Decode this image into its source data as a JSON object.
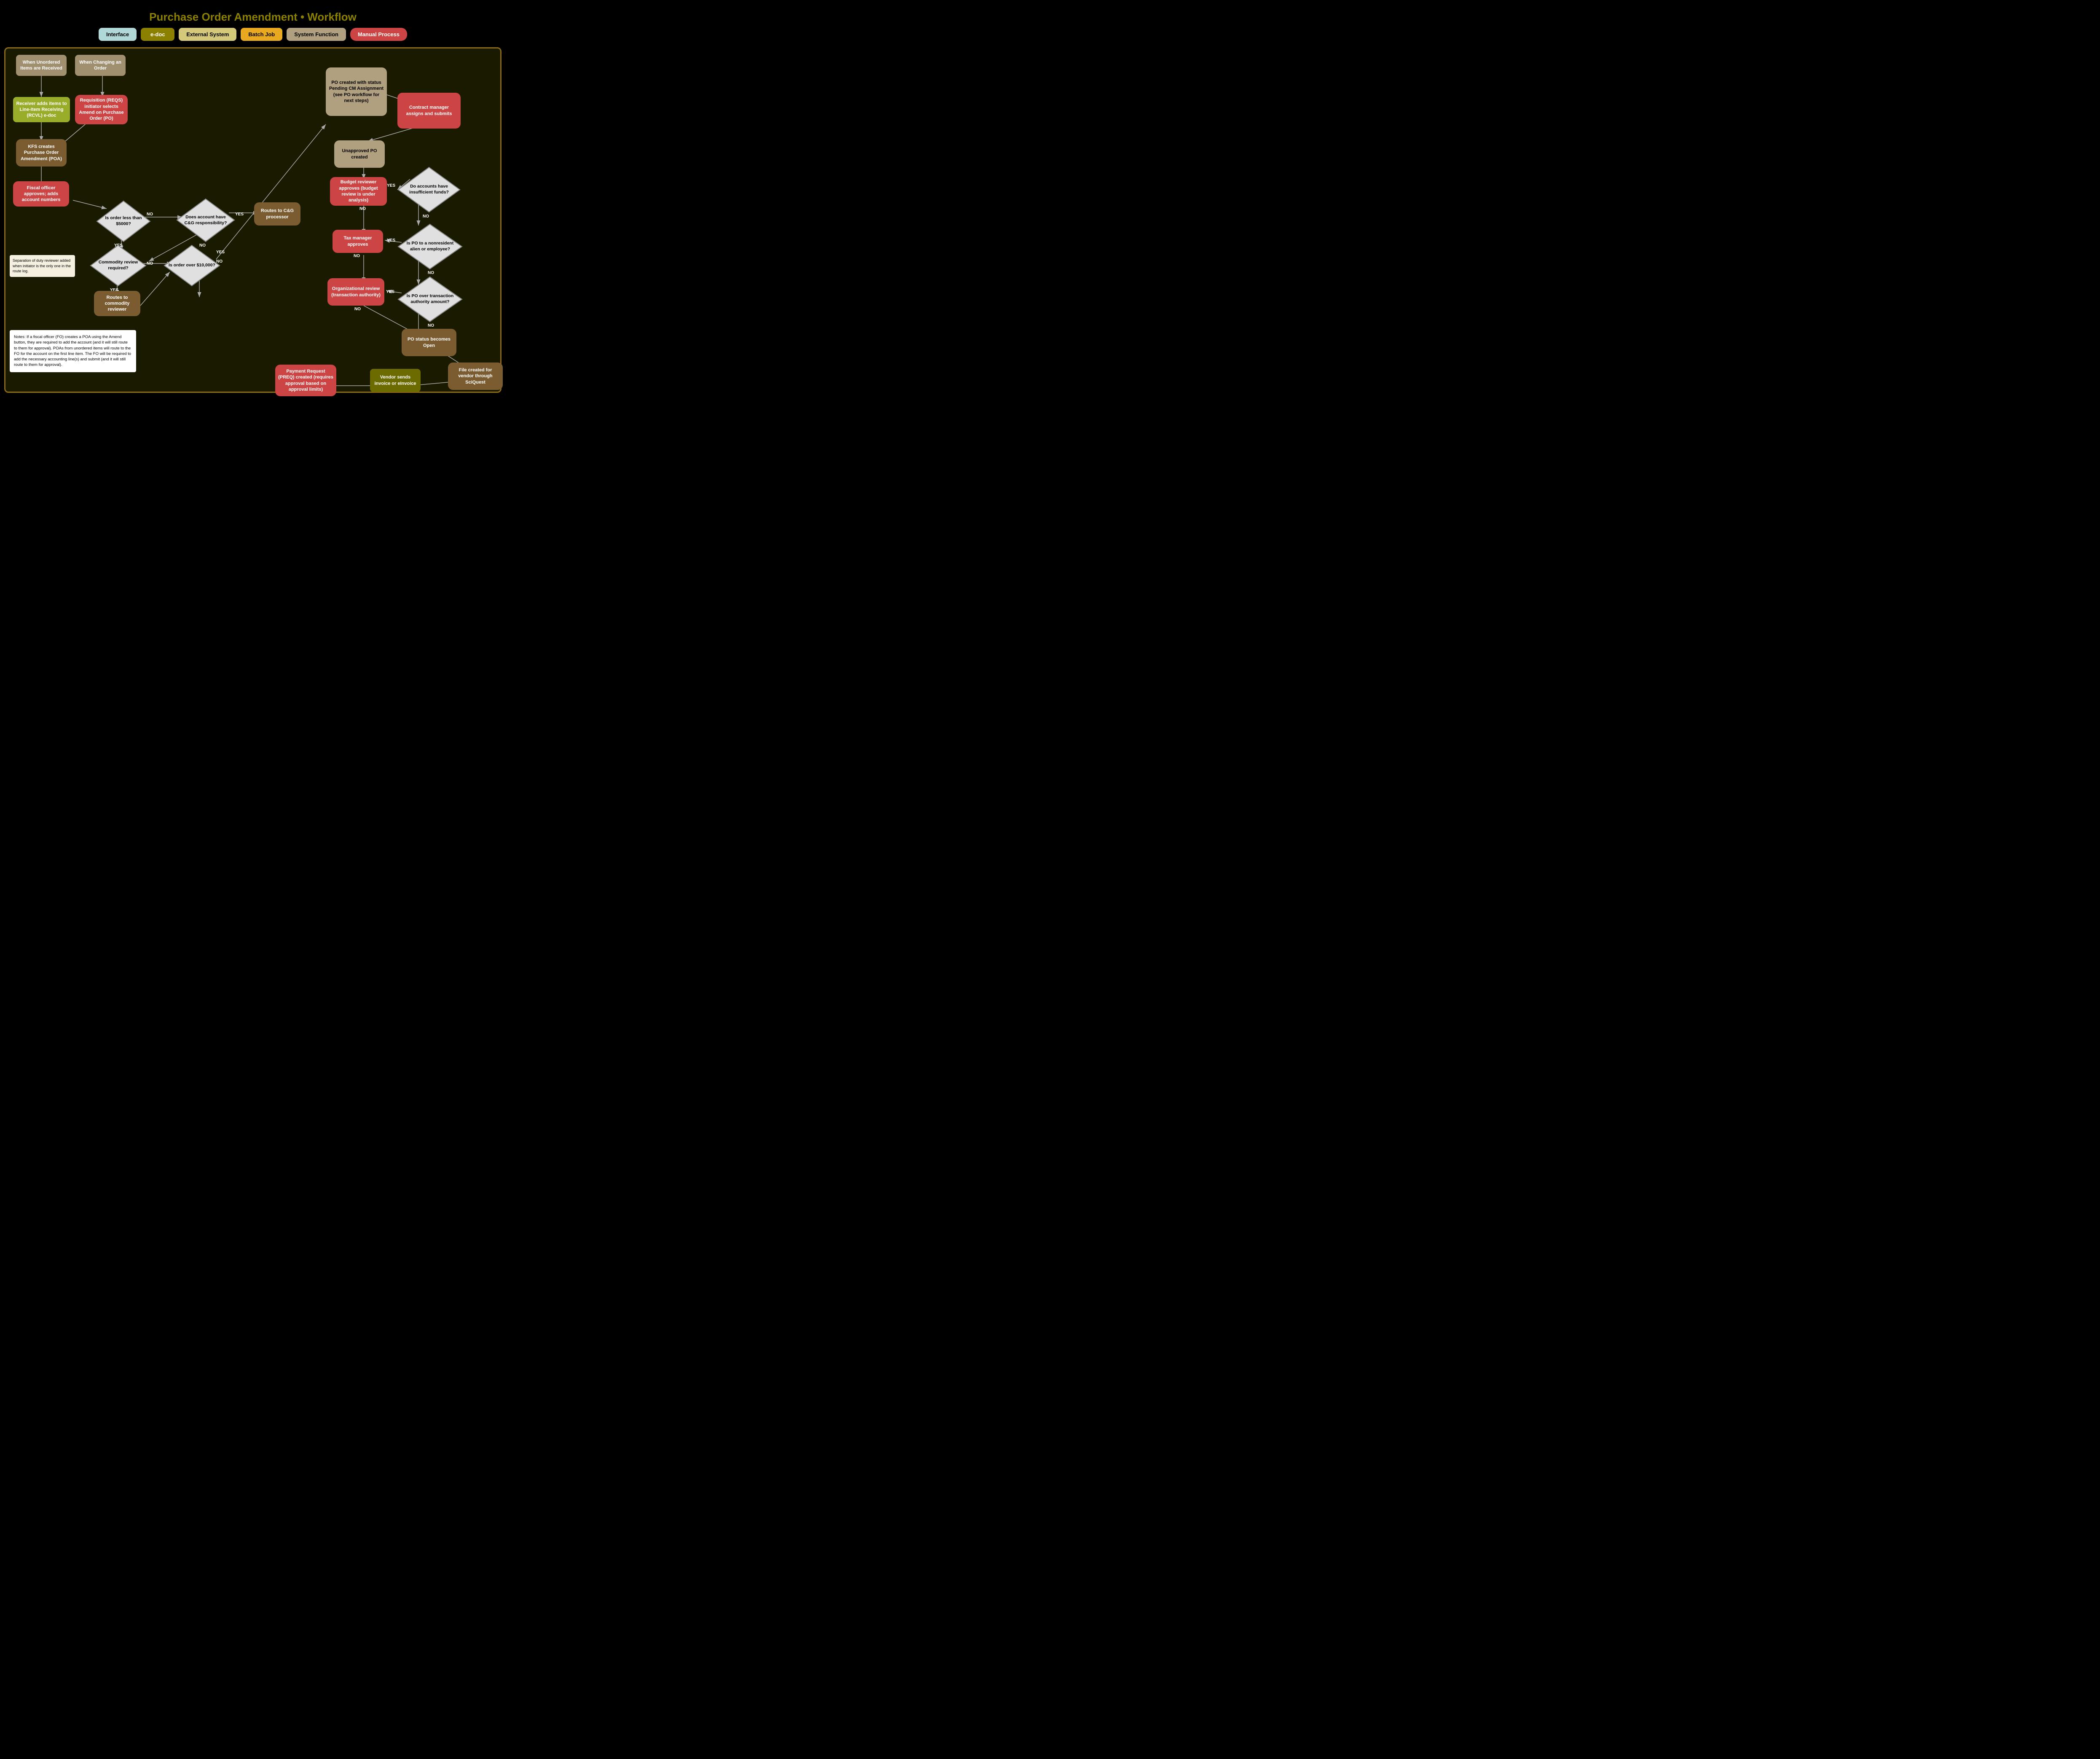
{
  "title": "Purchase Order Amendment • Workflow",
  "legend": {
    "items": [
      {
        "label": "Interface",
        "class": "legend-interface"
      },
      {
        "label": "e-doc",
        "class": "legend-edoc"
      },
      {
        "label": "External System",
        "class": "legend-external"
      },
      {
        "label": "Batch Job",
        "class": "legend-batch"
      },
      {
        "label": "System Function",
        "class": "legend-system"
      },
      {
        "label": "Manual Process",
        "class": "legend-manual"
      }
    ]
  },
  "nodes": {
    "when_unordered": "When Unordered Items are Received",
    "when_changing": "When Changing an Order",
    "receiver_adds": "Receiver adds items to Line-Item Receiving (RCVL) e-doc",
    "requisition": "Requisition (REQS) initiator selects Amend on Purchase Order (PO)",
    "kfs_creates": "KFS creates Purchase Order Amendment (POA)",
    "fiscal_officer": "Fiscal officer approves; adds account numbers",
    "separation": "Separation of duty reviewer added when initiator is the only one in the route log.",
    "routes_cg": "Routes to C&G processor",
    "routes_commodity": "Routes to commodity reviewer",
    "po_created_pending": "PO created with status Pending CM Assignment (see PO workflow for next steps)",
    "contract_manager": "Contract manager assigns and submits",
    "unapproved_po": "Unapproved PO created",
    "budget_reviewer": "Budget reviewer approves (budget review is under analysis)",
    "tax_manager": "Tax manager approves",
    "org_review": "Organizational review (transaction authority)",
    "po_status_open": "PO status becomes Open",
    "payment_request": "Payment Request (PREQ) created (requires approval based on approval limits)",
    "vendor_sends": "Vendor sends invoice or eInvoice",
    "file_created": "File created for vendor through SciQuest",
    "diamond_5000": "Is order less than $5000?",
    "diamond_cg": "Does account have C&G responsibility?",
    "diamond_commodity": "Commodity review required?",
    "diamond_10000": "Is order over $10,000?",
    "diamond_accounts": "Do accounts have insufficient funds?",
    "diamond_nonresident": "Is PO to a nonresident alien or employee?",
    "diamond_transaction": "Is PO over transaction authority amount?"
  },
  "notes": "Notes:\nIf a fiscal officer (FO) creates a POA using the Amend button, they are required to add the account (and it will still route to them for approval).\n\nPOAs from unordered items will route to the FO for the account on the first line item. The FO will be required to add the necessary accounting line(s) and submit (and it will still route to them for approval).",
  "labels": {
    "yes": "YES",
    "no": "NO"
  }
}
